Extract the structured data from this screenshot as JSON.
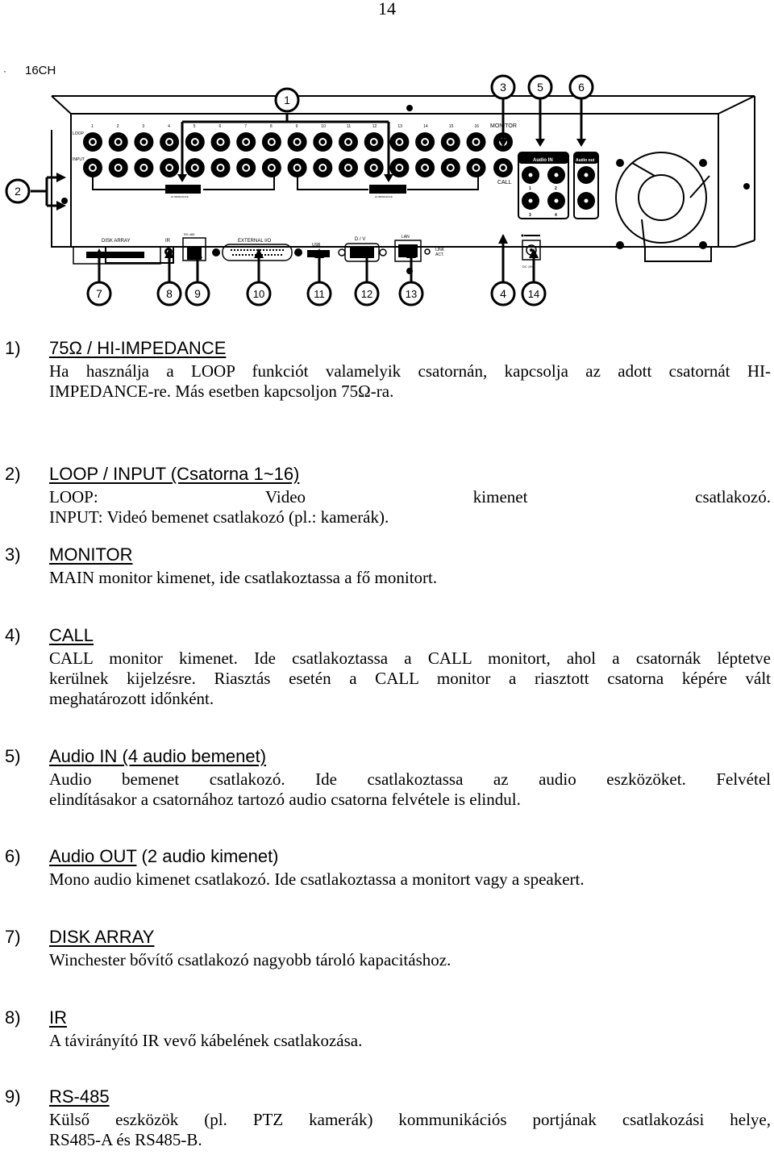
{
  "page": {
    "number": "14"
  },
  "diagram": {
    "model_label": "16CH",
    "bullet": "·",
    "row_labels": {
      "loop": "LOOP",
      "input": "INPUT"
    },
    "channels": [
      "1",
      "2",
      "3",
      "4",
      "5",
      "6",
      "7",
      "8",
      "9",
      "10",
      "11",
      "12",
      "13",
      "14",
      "15",
      "16"
    ],
    "monitor_label": "MONITOR",
    "call_label": "CALL",
    "audio_in": {
      "label": "Audio IN",
      "ports": [
        "1",
        "2",
        "3",
        "4"
      ]
    },
    "audio_out": {
      "label": "Audio out"
    },
    "switch_label": "HI-IMPEDANCE",
    "ports": {
      "disk_array": "DISK ARRAY",
      "ir": "IR",
      "rs485": "RS 485",
      "external_io": "EXTERNAL I/O",
      "usb": "USB",
      "dv": "D / V",
      "lan": "LAN",
      "link_act": [
        "LINK",
        "ACT."
      ],
      "dc": "DC 19V"
    },
    "callouts_top": [
      "1",
      "3",
      "5",
      "6"
    ],
    "callouts_left": [
      "2"
    ],
    "callouts_bottom": [
      "7",
      "8",
      "9",
      "10",
      "11",
      "12",
      "13",
      "4",
      "14"
    ]
  },
  "sections": [
    {
      "num": "1)",
      "title": "75Ω / HI-IMPEDANCE",
      "title_extra": "",
      "lines": [
        "Ha használja a LOOP funkciót valamelyik csatornán, kapcsolja az adott csatornát HI-",
        "IMPEDANCE-re. Más esetben kapcsoljon 75Ω-ra."
      ]
    },
    {
      "num": "2)",
      "title": "LOOP / INPUT (Csatorna 1~16)",
      "title_extra": "",
      "lines": [
        "LOOP: Video kimenet csatlakozó.",
        "INPUT: Videó bemenet csatlakozó (pl.: kamerák)."
      ]
    },
    {
      "num": "3)",
      "title": "MONITOR",
      "title_extra": "",
      "lines": [
        "MAIN monitor kimenet, ide csatlakoztassa a fő monitort."
      ]
    },
    {
      "num": "4)",
      "title": "CALL",
      "title_extra": "",
      "lines": [
        "CALL monitor kimenet. Ide csatlakoztassa a CALL monitort, ahol a csatornák léptetve",
        "kerülnek kijelzésre. Riasztás esetén a CALL monitor a riasztott csatorna képére vált",
        "meghatározott időnként."
      ]
    },
    {
      "num": "5)",
      "title": "Audio IN (4 audio bemenet)",
      "title_extra": "",
      "lines": [
        "Audio bemenet csatlakozó. Ide csatlakoztassa az audio eszközöket. Felvétel",
        "elindításakor a csatornához tartozó audio csatorna felvétele is elindul."
      ]
    },
    {
      "num": "6)",
      "title": "Audio OUT",
      "title_extra": " (2 audio kimenet)",
      "lines": [
        "Mono audio kimenet csatlakozó. Ide csatlakoztassa a monitort vagy a speakert."
      ]
    },
    {
      "num": "7)",
      "title": "DISK ARRAY",
      "title_extra": "",
      "lines": [
        "Winchester bővítő csatlakozó nagyobb tároló kapacitáshoz."
      ]
    },
    {
      "num": "8)",
      "title": "IR",
      "title_extra": "",
      "lines": [
        "A távirányító IR vevő kábelének csatlakozása."
      ]
    },
    {
      "num": "9)",
      "title": "RS-485",
      "title_extra": "",
      "lines": [
        "Külső eszközök (pl. PTZ kamerák) kommunikációs portjának csatlakozási helye,",
        "RS485-A és RS485-B."
      ]
    }
  ]
}
